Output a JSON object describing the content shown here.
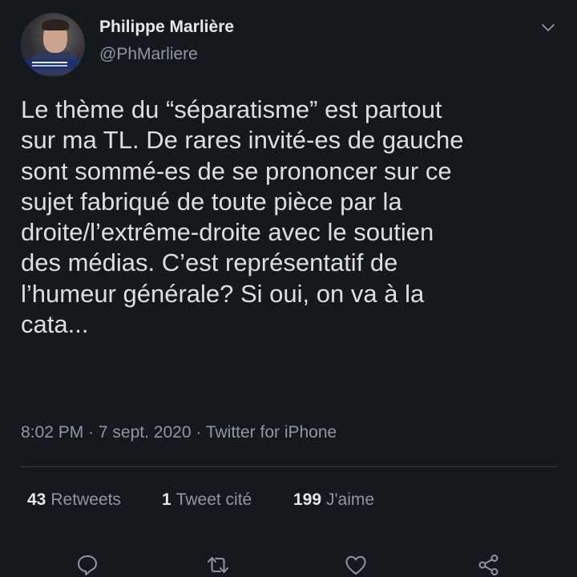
{
  "tweet": {
    "author": {
      "display_name": "Philippe Marlière",
      "handle": "@PhMarliere"
    },
    "text": "Le thème du “séparatisme” est partout\nsur ma TL. De rares invité-es de gauche\nsont sommé-es de se prononcer sur ce\nsujet fabriqué de toute pièce par la\ndroite/l’extrême-droite avec le soutien\ndes médias. C’est représentatif de\nl’humeur générale? Si oui, on va à la\ncata...",
    "meta": {
      "time": "8:02 PM",
      "separator": "·",
      "date": "7 sept. 2020",
      "source": "Twitter for iPhone"
    },
    "stats": {
      "retweets_count": "43",
      "retweets_label": "Retweets",
      "quotes_count": "1",
      "quotes_label": "Tweet cité",
      "likes_count": "199",
      "likes_label": "J'aime"
    },
    "icons": {
      "more": "chevron-down-icon",
      "reply": "reply-icon",
      "retweet": "retweet-icon",
      "like": "heart-icon",
      "share": "share-icon"
    },
    "colors": {
      "background": "#15181c",
      "text": "#dedede",
      "secondary": "#8b98a5",
      "divider": "#38444d"
    }
  }
}
